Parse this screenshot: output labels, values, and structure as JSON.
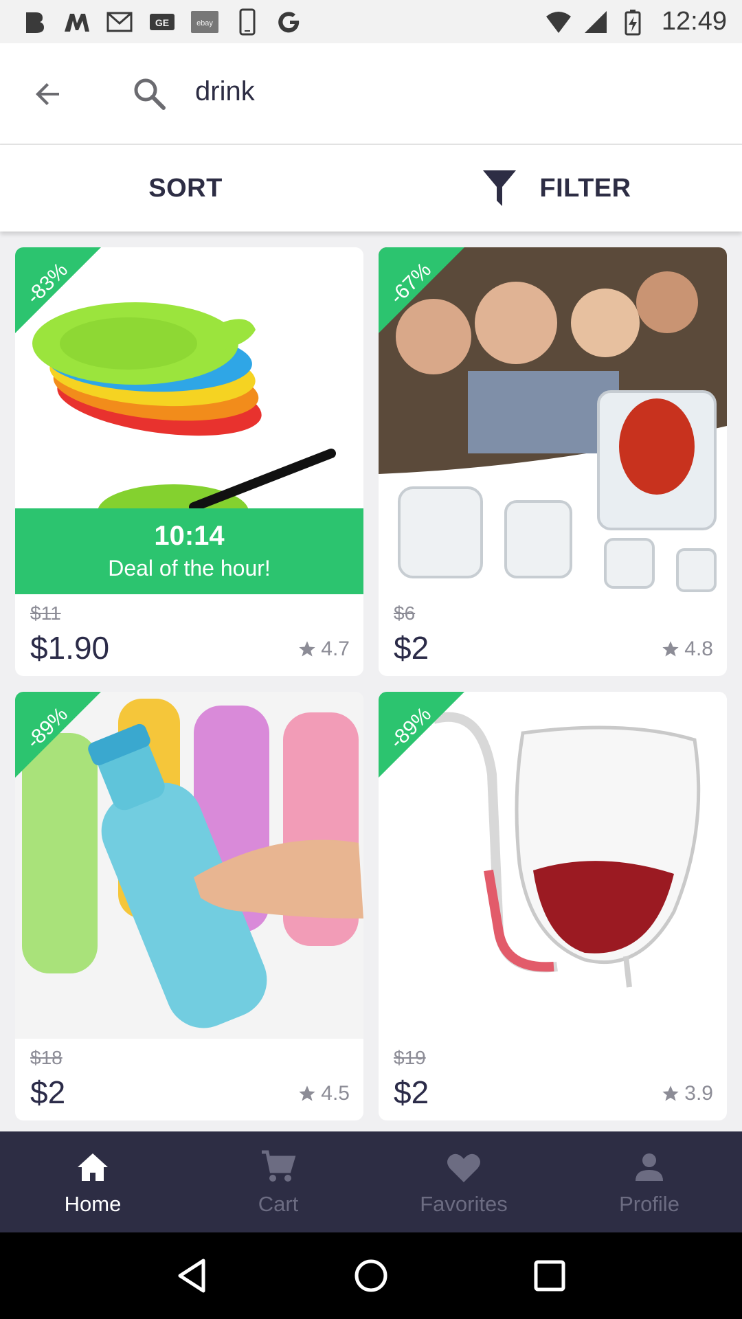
{
  "status_bar": {
    "time": "12:49",
    "left_icons": [
      "b-app-icon",
      "m-app-icon",
      "gmail-icon",
      "ge-app-icon",
      "ebay-icon",
      "phone-icon",
      "google-icon"
    ],
    "ebay_label": "ebay",
    "ge_label": "GE",
    "right_icons": [
      "wifi-icon",
      "signal-icon",
      "battery-icon"
    ]
  },
  "search": {
    "query": "drink"
  },
  "toolbar": {
    "sort_label": "SORT",
    "filter_label": "FILTER"
  },
  "products": [
    {
      "discount": "-83%",
      "deal_time": "10:14",
      "deal_label": "Deal of the hour!",
      "old_price": "$11",
      "price": "$1.90",
      "rating": "4.7"
    },
    {
      "discount": "-67%",
      "old_price": "$6",
      "price": "$2",
      "rating": "4.8"
    },
    {
      "discount": "-89%",
      "old_price": "$18",
      "price": "$2",
      "rating": "4.5"
    },
    {
      "discount": "-89%",
      "old_price": "$19",
      "price": "$2",
      "rating": "3.9"
    }
  ],
  "bottom_nav": {
    "items": [
      {
        "label": "Home",
        "icon": "home-icon",
        "active": true
      },
      {
        "label": "Cart",
        "icon": "cart-icon",
        "active": false
      },
      {
        "label": "Favorites",
        "icon": "heart-icon",
        "active": false
      },
      {
        "label": "Profile",
        "icon": "person-icon",
        "active": false
      }
    ]
  },
  "colors": {
    "accent": "#2cc46f",
    "nav_bg": "#2d2d44",
    "nav_active": "#ffffff",
    "nav_inactive": "#6c6c82"
  }
}
